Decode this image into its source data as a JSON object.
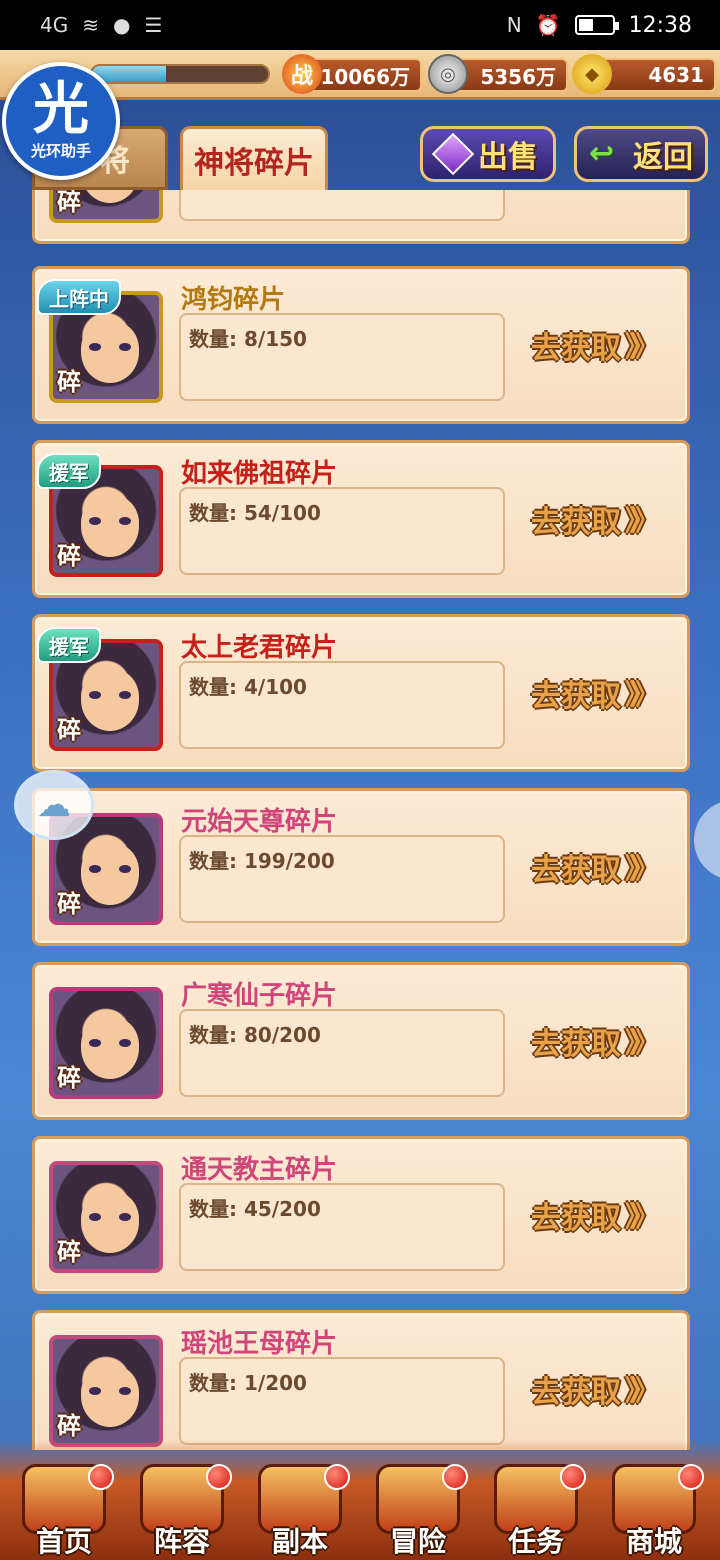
{
  "statusbar": {
    "network": "4G",
    "time": "12:38"
  },
  "resources": {
    "battle_power": "10066万",
    "silver": "5356万",
    "gold": "4631",
    "exp_progress": 0.42,
    "battle_icon_text": "战"
  },
  "helper": {
    "glyph": "光",
    "label": "光环助手"
  },
  "tabs": {
    "inactive": "将",
    "active": "神将碎片"
  },
  "buttons": {
    "sell": "出售",
    "back": "返回"
  },
  "shard_marker": "碎",
  "go_label": "去获取",
  "go_arrows": "》》",
  "count_label": "数量:",
  "items": [
    {
      "name": "鸿钧碎片",
      "count": "8/150",
      "badge": "上阵中",
      "title_color": "gold",
      "frame": "gold"
    },
    {
      "name": "如来佛祖碎片",
      "count": "54/100",
      "badge": "援军",
      "title_color": "red",
      "frame": "red"
    },
    {
      "name": "太上老君碎片",
      "count": "4/100",
      "badge": "援军",
      "title_color": "red",
      "frame": "red"
    },
    {
      "name": "元始天尊碎片",
      "count": "199/200",
      "badge": "",
      "title_color": "pink",
      "frame": "purple"
    },
    {
      "name": "广寒仙子碎片",
      "count": "80/200",
      "badge": "",
      "title_color": "pink",
      "frame": "purple"
    },
    {
      "name": "通天教主碎片",
      "count": "45/200",
      "badge": "",
      "title_color": "pink",
      "frame": "pink"
    },
    {
      "name": "瑶池王母碎片",
      "count": "1/200",
      "badge": "",
      "title_color": "pink",
      "frame": "pink"
    }
  ],
  "nav": [
    {
      "label": "首页",
      "icon": "home-icon"
    },
    {
      "label": "阵容",
      "icon": "lineup-icon"
    },
    {
      "label": "副本",
      "icon": "dungeon-icon"
    },
    {
      "label": "冒险",
      "icon": "adventure-icon"
    },
    {
      "label": "任务",
      "icon": "quest-icon"
    },
    {
      "label": "商城",
      "icon": "shop-icon"
    }
  ]
}
